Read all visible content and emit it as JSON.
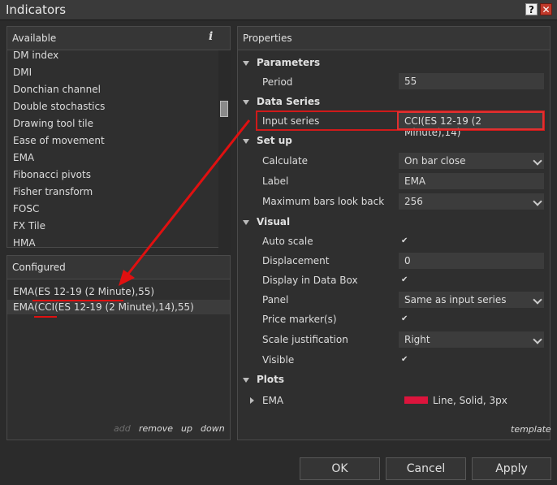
{
  "window": {
    "title": "Indicators"
  },
  "available": {
    "header": "Available",
    "info_icon": "i",
    "items": [
      "DM index",
      "DMI",
      "Donchian channel",
      "Double stochastics",
      "Drawing tool tile",
      "Ease of movement",
      "EMA",
      "Fibonacci pivots",
      "Fisher transform",
      "FOSC",
      "FX Tile",
      "HMA"
    ]
  },
  "configured": {
    "header": "Configured",
    "items": [
      "EMA(ES 12-19 (2 Minute),55)",
      "EMA(CCI(ES 12-19 (2 Minute),14),55)"
    ],
    "actions": {
      "add": "add",
      "remove": "remove",
      "up": "up",
      "down": "down"
    }
  },
  "properties": {
    "header": "Properties",
    "sections": {
      "parameters": "Parameters",
      "data_series": "Data Series",
      "setup": "Set up",
      "visual": "Visual",
      "plots": "Plots"
    },
    "period": {
      "label": "Period",
      "value": "55"
    },
    "input_series": {
      "label": "Input series",
      "value": "CCI(ES 12-19 (2 Minute),14)"
    },
    "calculate": {
      "label": "Calculate",
      "value": "On bar close"
    },
    "label": {
      "label": "Label",
      "value": "EMA"
    },
    "max_bars": {
      "label": "Maximum bars look back",
      "value": "256"
    },
    "auto_scale": {
      "label": "Auto scale",
      "checked": true
    },
    "displacement": {
      "label": "Displacement",
      "value": "0"
    },
    "display_data_box": {
      "label": "Display in Data Box",
      "checked": true
    },
    "panel": {
      "label": "Panel",
      "value": "Same as input series"
    },
    "price_marker": {
      "label": "Price marker(s)",
      "checked": true
    },
    "scale_justification": {
      "label": "Scale justification",
      "value": "Right"
    },
    "visible": {
      "label": "Visible",
      "checked": true
    },
    "plot_ema": {
      "label": "EMA",
      "value": "Line, Solid, 3px",
      "color": "#dc143c"
    },
    "template_link": "template"
  },
  "buttons": {
    "ok": "OK",
    "cancel": "Cancel",
    "apply": "Apply"
  },
  "colors": {
    "annotation_red": "#e01010",
    "check": "✔"
  }
}
